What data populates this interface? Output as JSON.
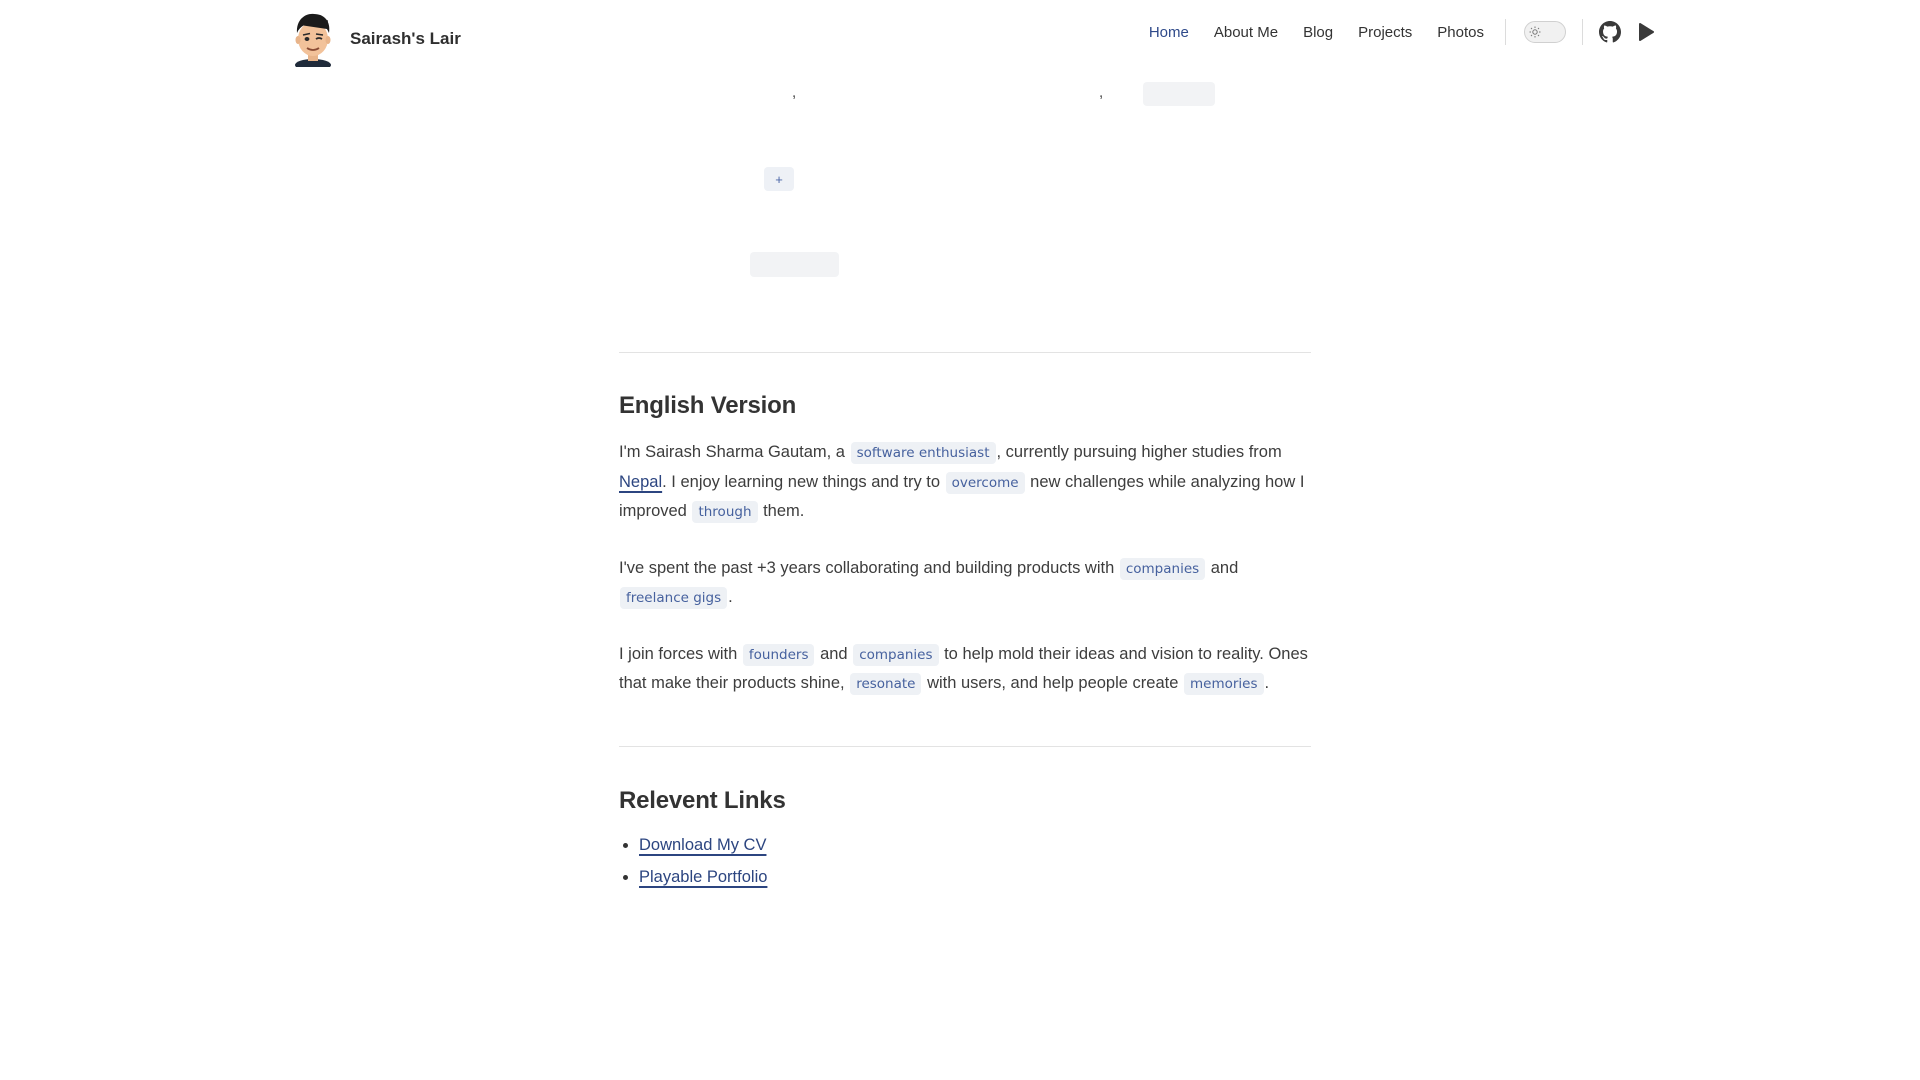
{
  "header": {
    "brand": "Sairash's Lair",
    "nav": [
      {
        "label": "Home",
        "active": true
      },
      {
        "label": "About Me",
        "active": false
      },
      {
        "label": "Blog",
        "active": false
      },
      {
        "label": "Projects",
        "active": false
      },
      {
        "label": "Photos",
        "active": false
      }
    ],
    "icons": {
      "theme_toggle": "sun-icon",
      "github": "github-icon",
      "play": "play-icon"
    }
  },
  "ghost": {
    "comma_1": ",",
    "comma_2": ",",
    "plus": "+"
  },
  "english": {
    "heading": "English Version",
    "p1": {
      "t1": "I'm Sairash Sharma Gautam, a ",
      "tag1": "software enthusiast",
      "t2": ", currently pursuing higher studies from ",
      "link": "Nepal",
      "t3": ". I enjoy learning new things and try to ",
      "tag2": "overcome",
      "t4": " new challenges while analyzing how I improved ",
      "tag3": "through",
      "t5": " them."
    },
    "p2": {
      "t1": "I've spent the past +3 years collaborating and building products with ",
      "tag1": "companies",
      "t2": " and ",
      "tag2": "freelance gigs",
      "t3": "."
    },
    "p3": {
      "t1": "I join forces with ",
      "tag1": "founders",
      "t2": " and ",
      "tag2": "companies",
      "t3": " to help mold their ideas and vision to reality. Ones that make their products shine, ",
      "tag3": "resonate",
      "t4": " with users, and help people create ",
      "tag4": "memories",
      "t5": "."
    }
  },
  "links": {
    "heading": "Relevent Links",
    "items": [
      "Download My CV",
      "Playable Portfolio"
    ]
  },
  "colors": {
    "accent": "#2f4a8a",
    "tag_bg": "#eef1f5",
    "tag_text": "#46619e"
  }
}
